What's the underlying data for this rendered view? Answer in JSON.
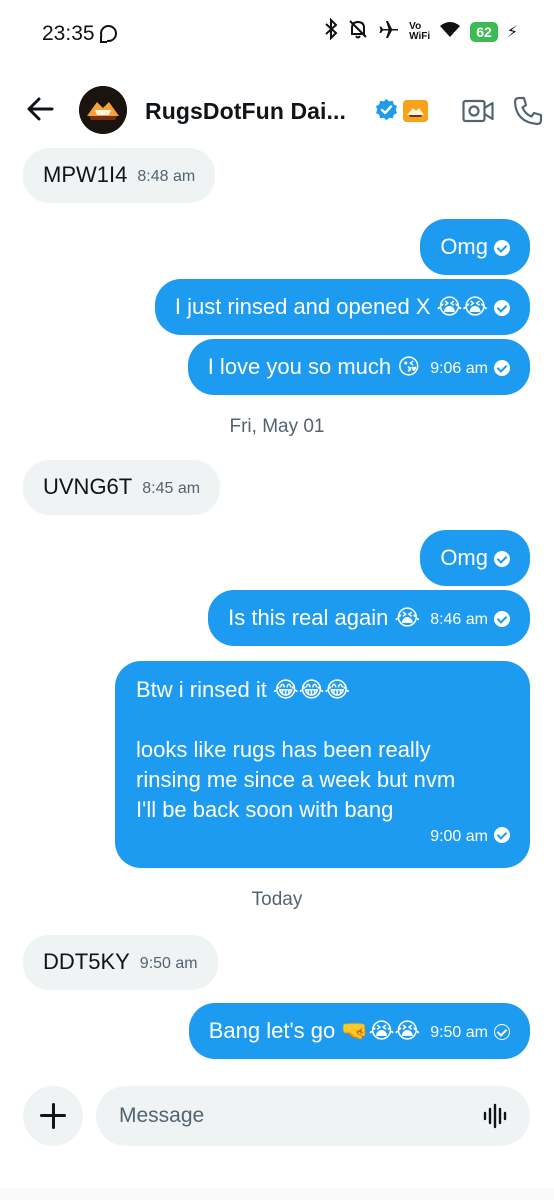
{
  "status_bar": {
    "time": "23:35",
    "network_label_top": "Vo",
    "network_label_bottom": "WiFi",
    "battery": "62"
  },
  "header": {
    "title": "RugsDotFun Dai...",
    "verified_icon": "verified-badge-icon",
    "accent_color": "#1d9bf0"
  },
  "messages": [
    {
      "dir": "in",
      "text": "MPW1I4",
      "time": "8:48 am"
    },
    {
      "dir": "out",
      "text": "Omg",
      "time": "",
      "status": "read"
    },
    {
      "dir": "out",
      "text": "I just rinsed and opened X 😭😭",
      "time": "",
      "status": "read"
    },
    {
      "dir": "out",
      "text": "I love you so much 😘",
      "time": "9:06 am",
      "status": "read"
    },
    {
      "dir": "in",
      "text": "UVNG6T",
      "time": "8:45 am"
    },
    {
      "dir": "out",
      "text": "Omg",
      "time": "",
      "status": "read"
    },
    {
      "dir": "out",
      "text": "Is this real again 😭",
      "time": "8:46 am",
      "status": "read"
    },
    {
      "dir": "out",
      "lines": [
        "Btw i rinsed it 😂😂😂",
        "",
        "looks like rugs has been really",
        "rinsing me since a week but nvm",
        "I'll be back soon with bang"
      ],
      "time": "9:00 am",
      "status": "read"
    },
    {
      "dir": "in",
      "text": "DDT5KY",
      "time": "9:50 am"
    },
    {
      "dir": "out",
      "text": "Bang let's go 🤜😭😭",
      "time": "9:50 am",
      "status": "sent"
    }
  ],
  "date_separators": [
    "Fri, May 01",
    "Today"
  ],
  "composer": {
    "placeholder": "Message"
  }
}
